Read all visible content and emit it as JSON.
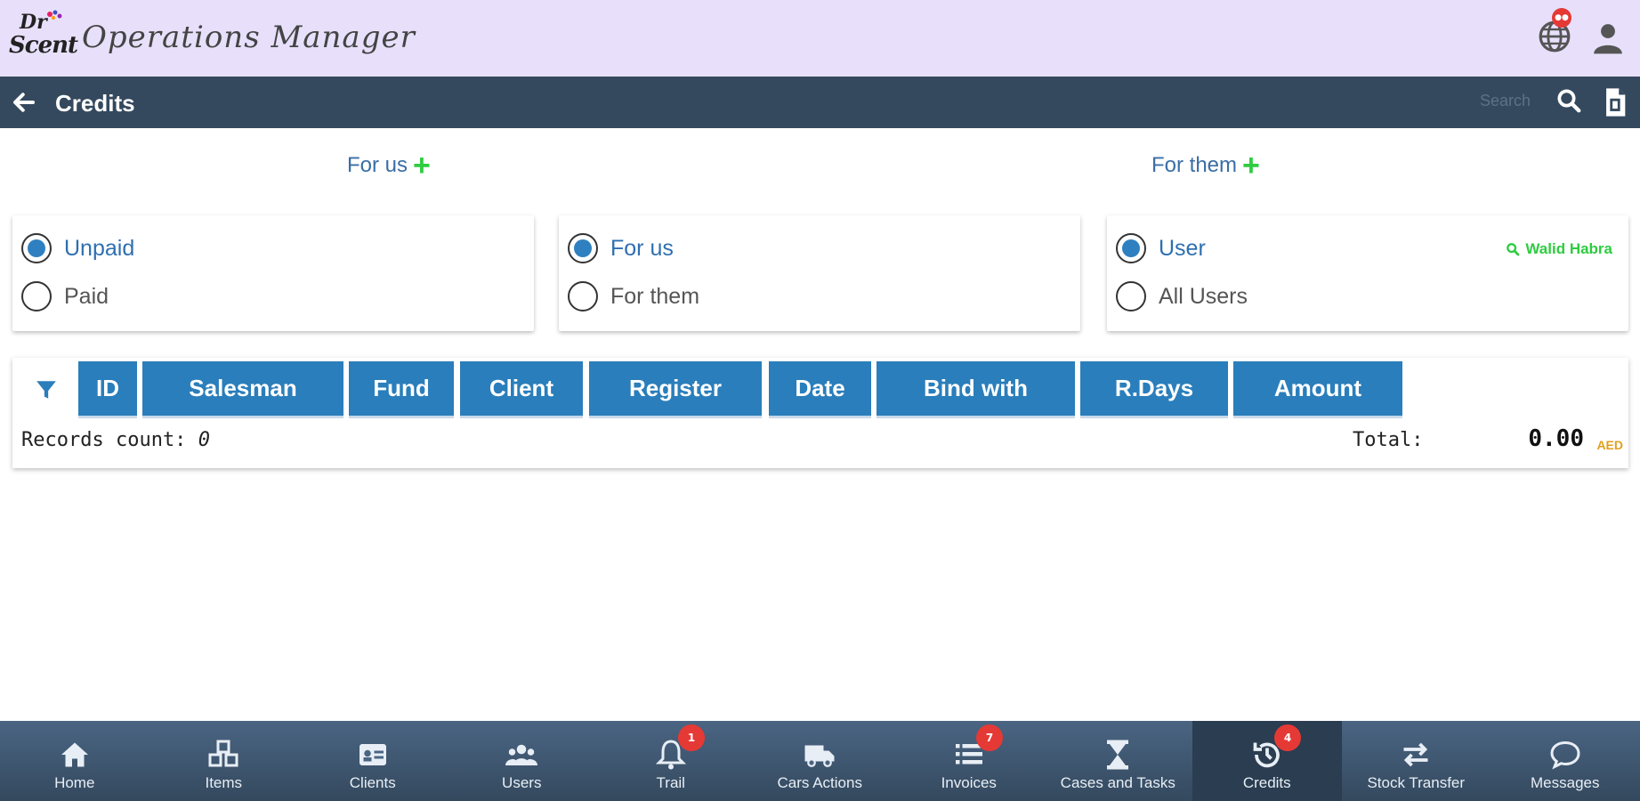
{
  "header": {
    "logo_text_top": "Dr",
    "logo_text_bottom": "Scent",
    "app_title": "Operations Manager",
    "globe_badge": "●●"
  },
  "subbar": {
    "title": "Credits",
    "search_placeholder": "Search"
  },
  "add_links": {
    "for_us": "For us",
    "for_them": "For them"
  },
  "filters": {
    "status": {
      "options": [
        "Unpaid",
        "Paid"
      ],
      "selected": "Unpaid"
    },
    "direction": {
      "options": [
        "For us",
        "For them"
      ],
      "selected": "For us"
    },
    "scope": {
      "options": [
        "User",
        "All Users"
      ],
      "selected": "User",
      "user_name": "Walid Habra"
    }
  },
  "table": {
    "columns": [
      "ID",
      "Salesman",
      "Fund",
      "Client",
      "Register",
      "Date",
      "Bind with",
      "R.Days",
      "Amount"
    ],
    "records_label": "Records count:",
    "records_count": "0",
    "total_label": "Total:",
    "total_value": "0.00",
    "currency": "AED"
  },
  "bottom_nav": [
    {
      "label": "Home",
      "icon": "home-icon",
      "badge": ""
    },
    {
      "label": "Items",
      "icon": "items-icon",
      "badge": ""
    },
    {
      "label": "Clients",
      "icon": "id-card-icon",
      "badge": ""
    },
    {
      "label": "Users",
      "icon": "users-icon",
      "badge": ""
    },
    {
      "label": "Trail",
      "icon": "bell-icon",
      "badge": "1"
    },
    {
      "label": "Cars Actions",
      "icon": "truck-icon",
      "badge": ""
    },
    {
      "label": "Invoices",
      "icon": "list-icon",
      "badge": "7"
    },
    {
      "label": "Cases and Tasks",
      "icon": "hourglass-icon",
      "badge": ""
    },
    {
      "label": "Credits",
      "icon": "history-icon",
      "badge": "4",
      "active": true
    },
    {
      "label": "Stock Transfer",
      "icon": "transfer-icon",
      "badge": ""
    },
    {
      "label": "Messages",
      "icon": "chat-icon",
      "badge": ""
    }
  ],
  "colors": {
    "header_bg": "#e8e0fb",
    "subbar_bg": "#34495e",
    "table_header": "#2a7ebb",
    "accent_green": "#2ecc40",
    "badge_red": "#e53935"
  }
}
